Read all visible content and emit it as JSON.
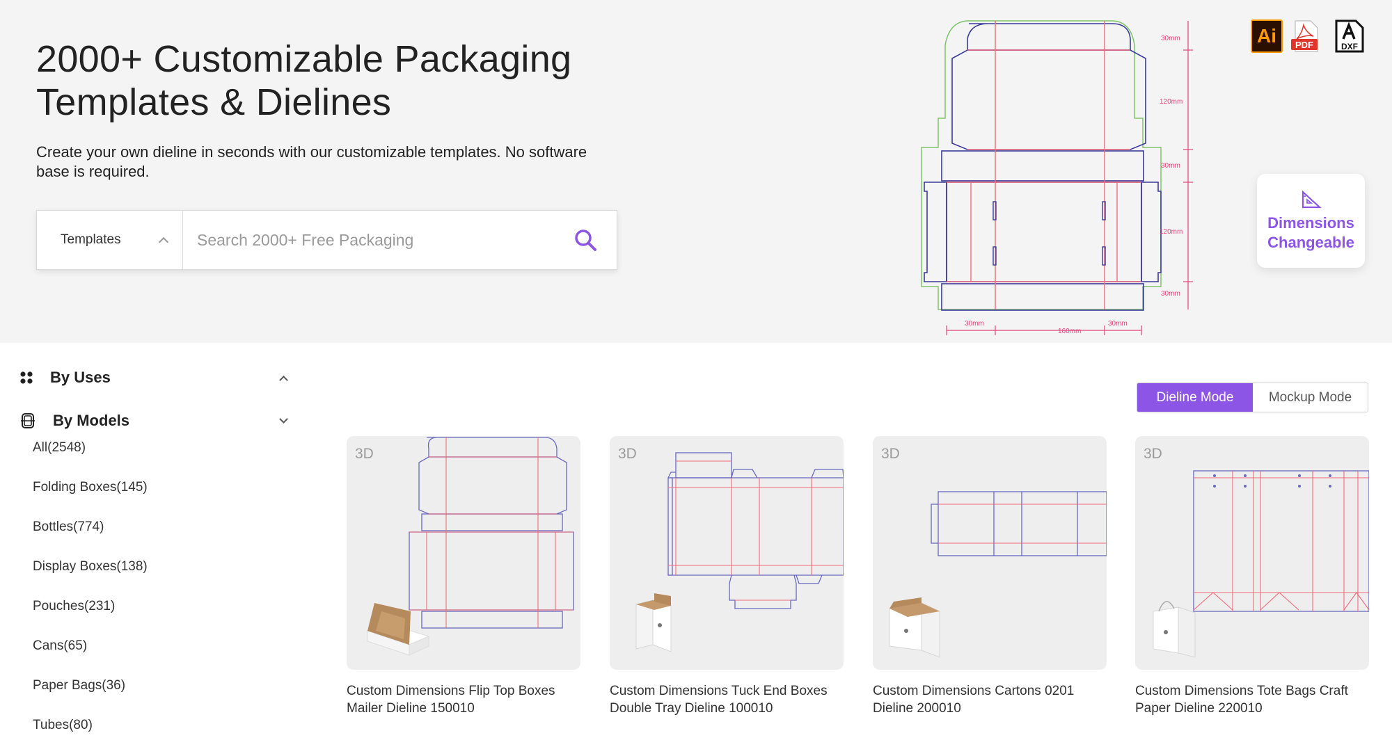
{
  "hero": {
    "title_line1": "2000+ Customizable Packaging",
    "title_line2": "Templates & Dielines",
    "subtitle": "Create your own dieline in seconds with our customizable templates. No software base is required.",
    "dims": {
      "top_flap": "30mm",
      "top_panel": "120mm",
      "mid_flap": "30mm",
      "bottom_panel": "120mm",
      "bottom_flap": "30mm",
      "left_flap": "30mm",
      "width": "160mm",
      "right_flap": "30mm"
    }
  },
  "search": {
    "category": "Templates",
    "placeholder": "Search 2000+ Free Packaging"
  },
  "file_formats": {
    "ai": "Ai",
    "pdf": "PDF",
    "dxf": "DXF"
  },
  "dimensions_card": {
    "line1": "Dimensions",
    "line2": "Changeable"
  },
  "sidebar": {
    "by_uses": "By Uses",
    "by_models": "By Models",
    "items": [
      "All(2548)",
      "Folding Boxes(145)",
      "Bottles(774)",
      "Display Boxes(138)",
      "Pouches(231)",
      "Cans(65)",
      "Paper Bags(36)",
      "Tubes(80)"
    ]
  },
  "mode_toggle": {
    "dieline": "Dieline Mode",
    "mockup": "Mockup Mode"
  },
  "cards": [
    {
      "badge": "3D",
      "title": "Custom Dimensions Flip Top Boxes Mailer Dieline 150010"
    },
    {
      "badge": "3D",
      "title": "Custom Dimensions Tuck End Boxes Double Tray Dieline 100010"
    },
    {
      "badge": "3D",
      "title": "Custom Dimensions Cartons 0201 Dieline 200010"
    },
    {
      "badge": "3D",
      "title": "Custom Dimensions Tote Bags Craft Paper Dieline 220010"
    }
  ],
  "colors": {
    "accent": "#8c55e6",
    "cut_line": "#5b5bb5",
    "fold_line": "#f06b7a",
    "dim_line": "#e0457b"
  }
}
